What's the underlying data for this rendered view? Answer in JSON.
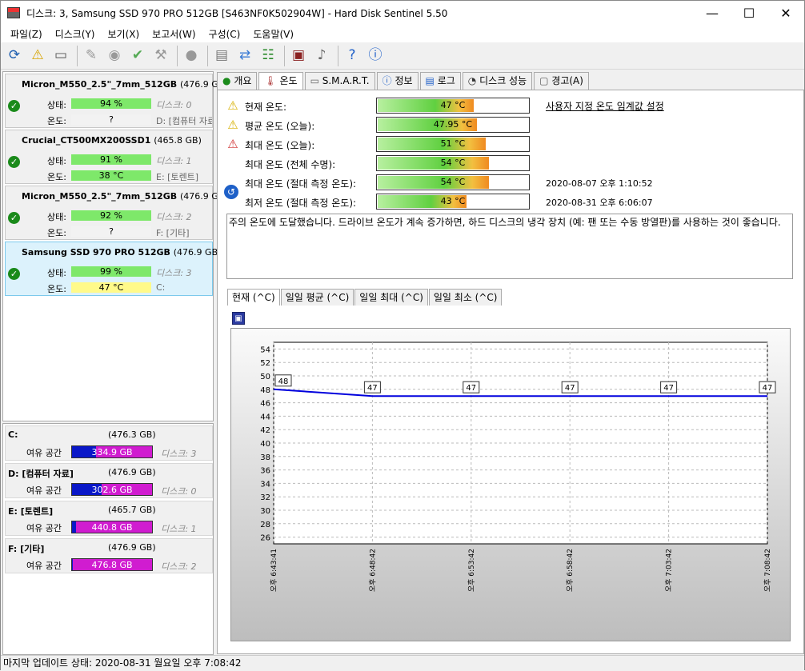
{
  "window": {
    "title": "디스크: 3, Samsung SSD 970 PRO 512GB [S463NF0K502904W]  -  Hard Disk Sentinel 5.50",
    "minimize_glyph": "—",
    "maximize_glyph": "☐",
    "close_glyph": "✕"
  },
  "menu": [
    "파일(Z)",
    "디스크(Y)",
    "보기(X)",
    "보고서(W)",
    "구성(C)",
    "도움말(V)"
  ],
  "toolbar_icons": [
    "refresh-icon",
    "warning-icon",
    "drive-icon",
    "wrench-icon",
    "disk-check-icon",
    "disk-verify-icon",
    "tool-icon",
    "circle-icon",
    "report-icon",
    "sync-icon",
    "network-icon",
    "monitor-icon",
    "sound-icon",
    "help-icon",
    "info-icon"
  ],
  "labels": {
    "status": "상태:",
    "temperature": "온도:",
    "free_space": "여유 공간"
  },
  "disks": [
    {
      "name": "Micron_M550_2.5\"_7mm_512GB",
      "size": "(476.9 GB)",
      "health": "94 %",
      "health_pct": 94,
      "temp": "?",
      "disk_label": "디스크: 0",
      "drive_letter": "D: [컴퓨터 자료]",
      "temp_color": "#f2f2f2"
    },
    {
      "name": "Crucial_CT500MX200SSD1",
      "size": "(465.8 GB)",
      "health": "91 %",
      "health_pct": 91,
      "temp": "38 °C",
      "disk_label": "디스크: 1",
      "drive_letter": "E: [토렌트]",
      "temp_color": "#7ee86a"
    },
    {
      "name": "Micron_M550_2.5\"_7mm_512GB",
      "size": "(476.9 GB)",
      "health": "92 %",
      "health_pct": 92,
      "temp": "?",
      "disk_label": "디스크: 2",
      "drive_letter": "F: [기타]",
      "temp_color": "#f2f2f2"
    },
    {
      "name": "Samsung SSD 970 PRO 512GB",
      "size": "(476.9 GB)",
      "health": "99 %",
      "health_pct": 99,
      "temp": "47 °C",
      "disk_label": "디스크: 3",
      "drive_letter": "C:",
      "temp_color": "#fffa8a"
    }
  ],
  "volumes": [
    {
      "name": "C:",
      "size": "(476.3 GB)",
      "free": "334.9 GB",
      "free_pct": 70,
      "disk": "디스크: 3"
    },
    {
      "name": "D: [컴퓨터 자료]",
      "size": "(476.9 GB)",
      "free": "302.6 GB",
      "free_pct": 63,
      "disk": "디스크: 0"
    },
    {
      "name": "E: [토렌트]",
      "size": "(465.7 GB)",
      "free": "440.8 GB",
      "free_pct": 95,
      "disk": "디스크: 1"
    },
    {
      "name": "F: [기타]",
      "size": "(476.9 GB)",
      "free": "476.8 GB",
      "free_pct": 99,
      "disk": "디스크: 2"
    }
  ],
  "tabs": [
    "개요",
    "온도",
    "S.M.A.R.T.",
    "정보",
    "로그",
    "디스크 성능",
    "경고(A)"
  ],
  "active_tab": 1,
  "temperature": {
    "threshold_link": "사용자 지정 온도 임계값 설정",
    "rows": [
      {
        "label": "현재 온도:",
        "value": "47 °C",
        "level": 0.64,
        "stamp": "",
        "icon": "warning-icon"
      },
      {
        "label": "평균 온도 (오늘):",
        "value": "47.95 °C",
        "level": 0.66,
        "stamp": "",
        "icon": "warning-icon"
      },
      {
        "label": "최대 온도 (오늘):",
        "value": "51 °C",
        "level": 0.72,
        "stamp": "",
        "icon": "alert-icon"
      },
      {
        "label": "최대 온도 (전체 수명):",
        "value": "54 °C",
        "level": 0.74,
        "stamp": "",
        "icon": ""
      },
      {
        "label": "최대 온도 (절대 측정 온도):",
        "value": "54 °C",
        "level": 0.74,
        "stamp": "2020-08-07 오후 1:10:52",
        "icon": ""
      },
      {
        "label": "최저 온도 (절대 측정 온도):",
        "value": "43 °C",
        "level": 0.59,
        "stamp": "2020-08-31 오후 6:06:07",
        "icon": ""
      }
    ],
    "note": "주의 온도에 도달했습니다. 드라이브 온도가 계속 증가하면, 하드 디스크의 냉각 장치 (예: 팬 또는 수동 방열판)를 사용하는 것이 좋습니다."
  },
  "chart_tabs": [
    "현재 (^C)",
    "일일 평균 (^C)",
    "일일 최대 (^C)",
    "일일 최소 (^C)"
  ],
  "chart_data": {
    "type": "line",
    "x": [
      "오후 6:43:41",
      "오후 6:48:42",
      "오후 6:53:42",
      "오후 6:58:42",
      "오후 7:03:42",
      "오후 7:08:42"
    ],
    "values": [
      48,
      47,
      47,
      47,
      47,
      47
    ],
    "data_labels": [
      "48",
      "47",
      "47",
      "47",
      "47",
      "47"
    ],
    "yticks": [
      "54",
      "52",
      "50",
      "48",
      "46",
      "44",
      "42",
      "40",
      "38",
      "36",
      "34",
      "32",
      "30",
      "28",
      "26"
    ],
    "ylim": [
      25,
      55
    ],
    "grid": true,
    "line_color": "#0000dd"
  },
  "status_text": "마지막 업데이트 상태: 2020-08-31 월요일 오후 7:08:42"
}
